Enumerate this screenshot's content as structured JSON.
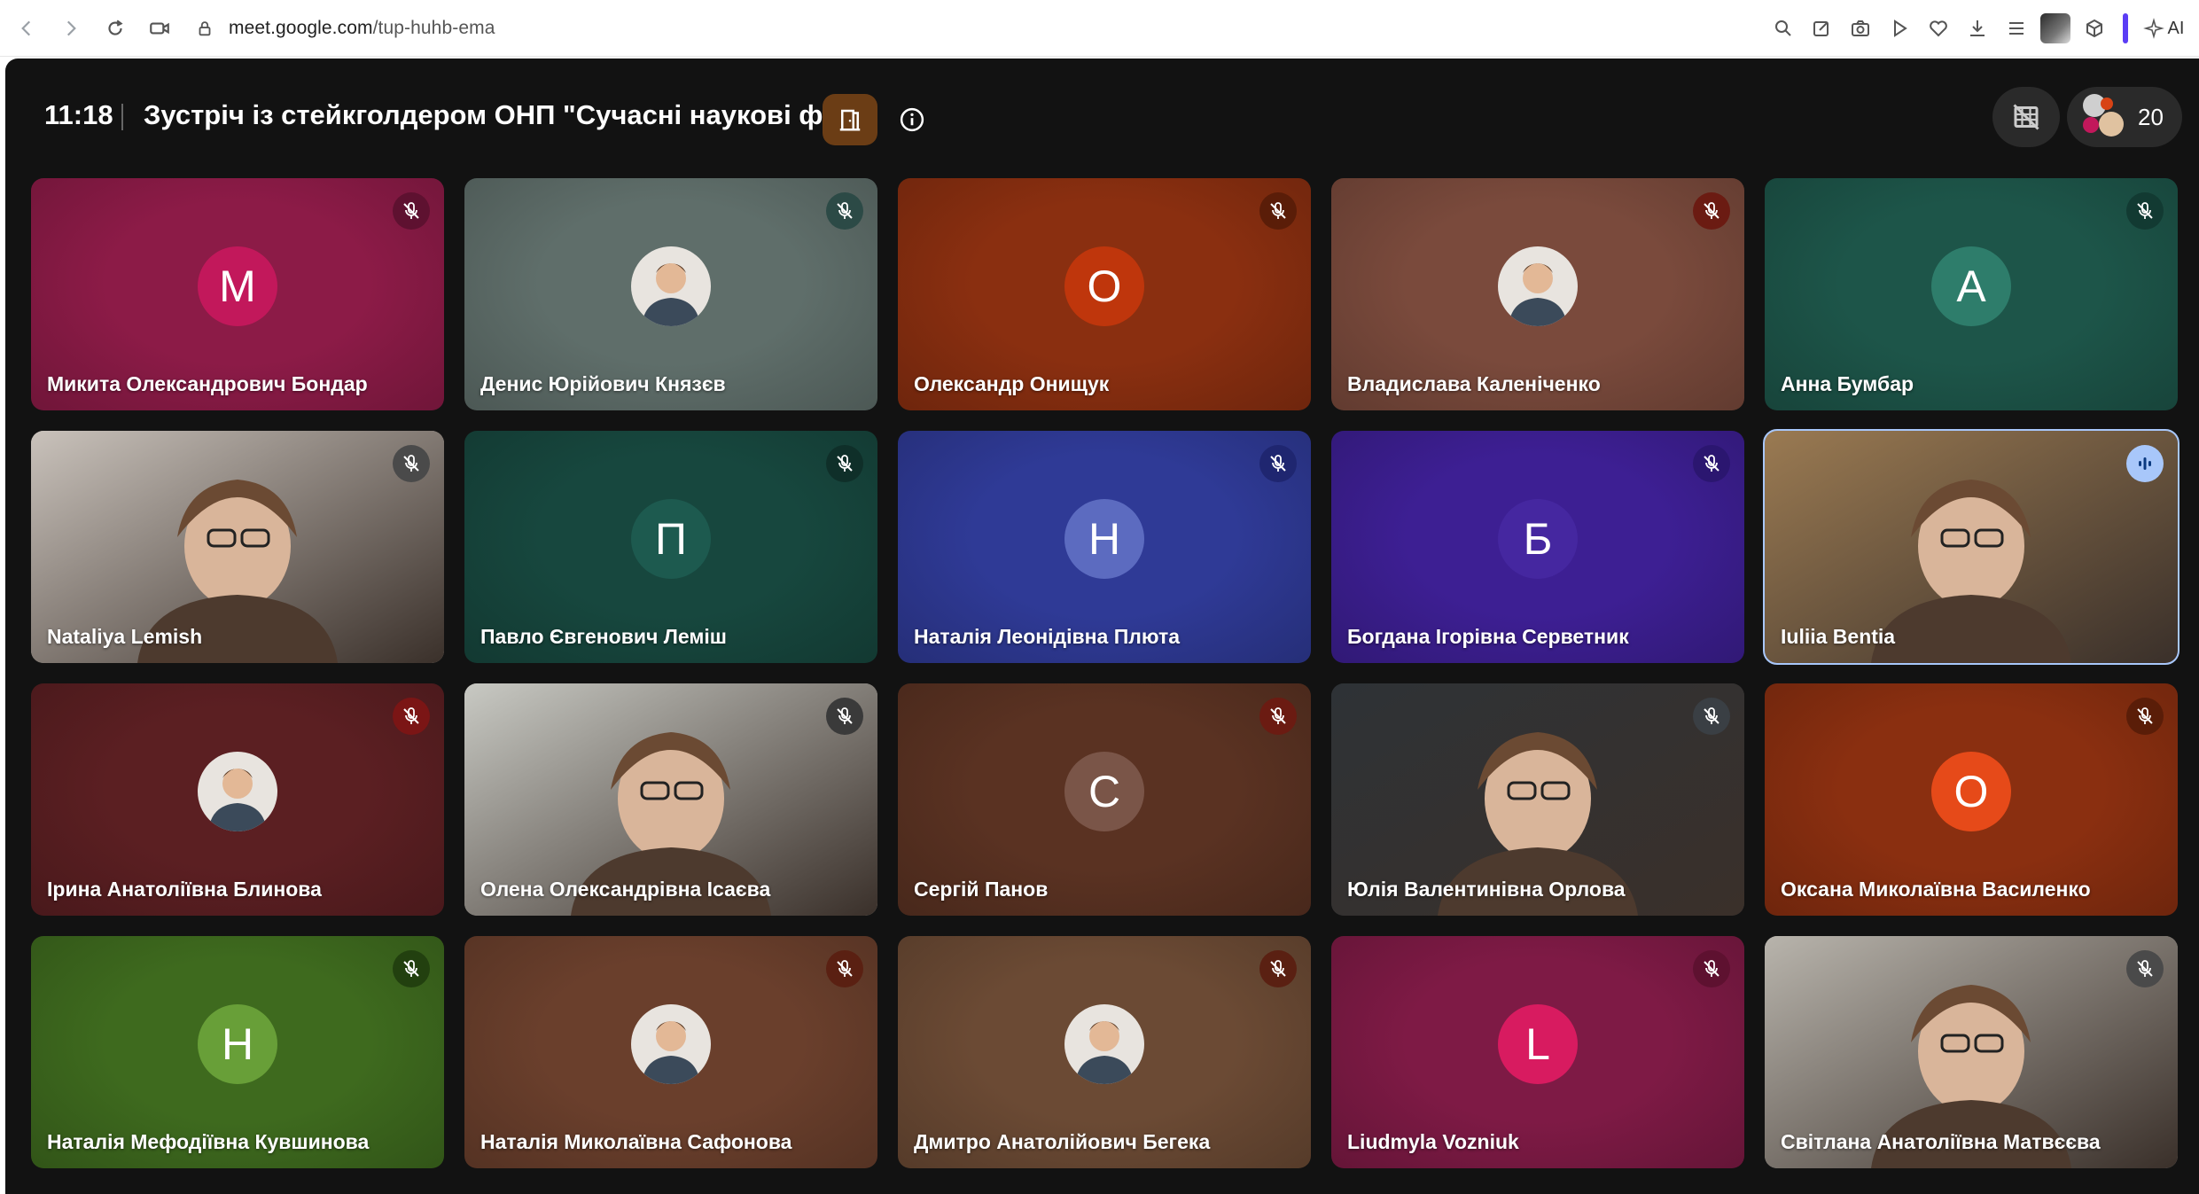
{
  "browser": {
    "url_host": "meet.google.com",
    "url_path": "/tup-huhb-ema",
    "ai_label": "AI"
  },
  "meeting": {
    "time": "11:18",
    "title": "Зустріч із стейкголдером ОНП \"Сучасні наукові фі...",
    "participant_count": "20"
  },
  "colors": {
    "meet_bg": "#121212",
    "active_speaker": "#a8c7fa"
  },
  "tiles": [
    {
      "name": "Микита Олександрович Бондар",
      "kind": "letter",
      "letter": "М",
      "bg": "#8c1b47",
      "circle": "#c2185b",
      "mic_bg": "#5e1130",
      "icon": "mic-off-icon"
    },
    {
      "name": "Денис Юрійович Князєв",
      "kind": "photo",
      "bg": "#5f6e6a",
      "mic_bg": "#2c4a46",
      "icon": "mic-off-icon"
    },
    {
      "name": "Олександр Онищук",
      "kind": "letter",
      "letter": "О",
      "bg": "#8a2f10",
      "circle": "#bf360c",
      "mic_bg": "#5a1d08",
      "icon": "mic-off-icon"
    },
    {
      "name": "Владислава Каленіченко",
      "kind": "photo",
      "bg": "#7a4a3c",
      "mic_bg": "#6b1b12",
      "icon": "mic-off-icon"
    },
    {
      "name": "Анна Бумбар",
      "kind": "letter",
      "letter": "А",
      "bg": "#1d5549",
      "circle": "#2e7d6b",
      "mic_bg": "#123a32",
      "icon": "mic-off-icon"
    },
    {
      "name": "Nataliya Lemish",
      "kind": "video",
      "bg": "#c9c2bb",
      "mic_bg": "#4a4a4a",
      "icon": "mic-off-icon"
    },
    {
      "name": "Павло Євгенович Леміш",
      "kind": "letter",
      "letter": "П",
      "bg": "#17473e",
      "circle": "#1d5a4f",
      "mic_bg": "#0f2f29",
      "icon": "mic-off-icon"
    },
    {
      "name": "Наталія Леонідівна Плюта",
      "kind": "letter",
      "letter": "Н",
      "bg": "#2f3a96",
      "circle": "#5c6bc0",
      "mic_bg": "#1f2670",
      "icon": "mic-off-icon"
    },
    {
      "name": "Богдана Ігорівна Серветник",
      "kind": "letter",
      "letter": "Б",
      "bg": "#3d1f93",
      "circle": "#4527a0",
      "mic_bg": "#2b1670",
      "icon": "mic-off-icon"
    },
    {
      "name": "Iuliia Bentia",
      "kind": "video",
      "bg": "#9a7a52",
      "mic_bg": "#a8c7fa",
      "icon": "speaking-icon",
      "active": true
    },
    {
      "name": "Ірина Анатоліївна Блинова",
      "kind": "photo",
      "bg": "#5b1f22",
      "mic_bg": "#7b1515",
      "icon": "mic-off-icon"
    },
    {
      "name": "Олена Олександрівна Ісаєва",
      "kind": "video",
      "bg": "#c8c9c3",
      "mic_bg": "#3a3a3a",
      "icon": "mic-off-icon"
    },
    {
      "name": "Сергій Панов",
      "kind": "letter",
      "letter": "С",
      "bg": "#5a3222",
      "circle": "#7a5548",
      "mic_bg": "#6b1b12",
      "icon": "mic-off-icon"
    },
    {
      "name": "Юлія Валентинівна Орлова",
      "kind": "video",
      "bg": "#2e3236",
      "mic_bg": "#3a3f44",
      "icon": "mic-off-icon"
    },
    {
      "name": "Оксана Миколаївна Василенко",
      "kind": "letter",
      "letter": "О",
      "bg": "#8a2f10",
      "circle": "#e64a19",
      "mic_bg": "#5a1d08",
      "icon": "mic-off-icon"
    },
    {
      "name": "Наталія Мефодіївна Кувшинова",
      "kind": "letter",
      "letter": "Н",
      "bg": "#3e6a1e",
      "circle": "#689f38",
      "mic_bg": "#22400f",
      "icon": "mic-off-icon"
    },
    {
      "name": "Наталія Миколаївна Сафонова",
      "kind": "photo",
      "bg": "#6a3f2c",
      "mic_bg": "#5a2012",
      "icon": "mic-off-icon"
    },
    {
      "name": "Дмитро Анатолійович Бегека",
      "kind": "photo",
      "bg": "#6b4a34",
      "mic_bg": "#5a2012",
      "icon": "mic-off-icon"
    },
    {
      "name": "Liudmyla Vozniuk",
      "kind": "letter",
      "letter": "L",
      "bg": "#7e1a45",
      "circle": "#d81b60",
      "mic_bg": "#5e1130",
      "icon": "mic-off-icon"
    },
    {
      "name": "Світлана Анатоліївна Матвєєва",
      "kind": "video",
      "bg": "#b8b4ac",
      "mic_bg": "#4a4a4a",
      "icon": "mic-off-icon"
    }
  ]
}
